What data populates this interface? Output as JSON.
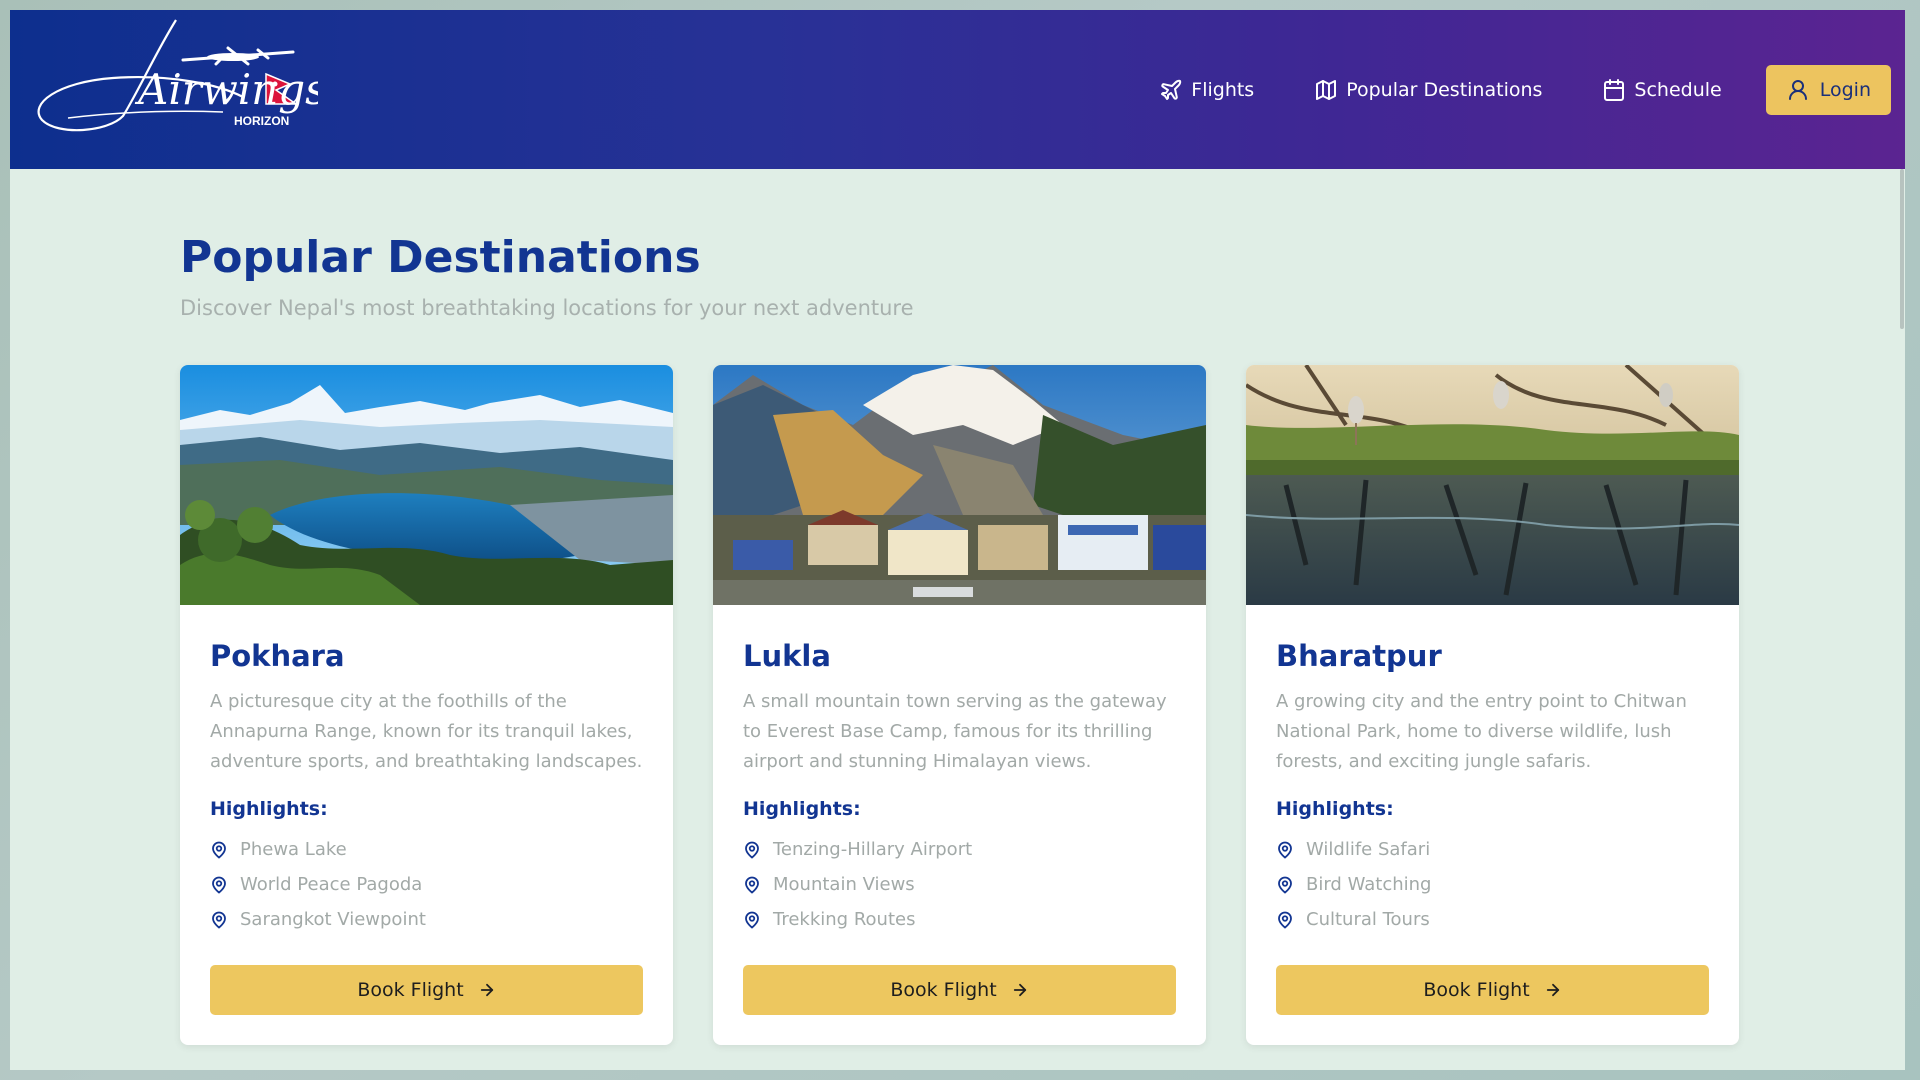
{
  "brand": {
    "logo_script": "Airwings",
    "logo_sub": "HORIZON"
  },
  "nav": {
    "flights": "Flights",
    "destinations": "Popular Destinations",
    "schedule": "Schedule",
    "login": "Login"
  },
  "page": {
    "title": "Popular Destinations",
    "subtitle": "Discover Nepal's most breathtaking locations for your next adventure"
  },
  "cards": [
    {
      "title": "Pokhara",
      "description": "A picturesque city at the foothills of the Annapurna Range, known for its tranquil lakes, adventure sports, and breathtaking landscapes.",
      "highlights_label": "Highlights:",
      "highlights": [
        "Phewa Lake",
        "World Peace Pagoda",
        "Sarangkot Viewpoint"
      ],
      "button": "Book Flight"
    },
    {
      "title": "Lukla",
      "description": "A small mountain town serving as the gateway to Everest Base Camp, famous for its thrilling airport and stunning Himalayan views.",
      "highlights_label": "Highlights:",
      "highlights": [
        "Tenzing-Hillary Airport",
        "Mountain Views",
        "Trekking Routes"
      ],
      "button": "Book Flight"
    },
    {
      "title": "Bharatpur",
      "description": "A growing city and the entry point to Chitwan National Park, home to diverse wildlife, lush forests, and exciting jungle safaris.",
      "highlights_label": "Highlights:",
      "highlights": [
        "Wildlife Safari",
        "Bird Watching",
        "Cultural Tours"
      ],
      "button": "Book Flight"
    }
  ],
  "colors": {
    "header_start": "#0d2f8e",
    "header_end": "#5b2491",
    "accent": "#edc45f",
    "heading": "#123592",
    "background": "#e0eee6"
  }
}
